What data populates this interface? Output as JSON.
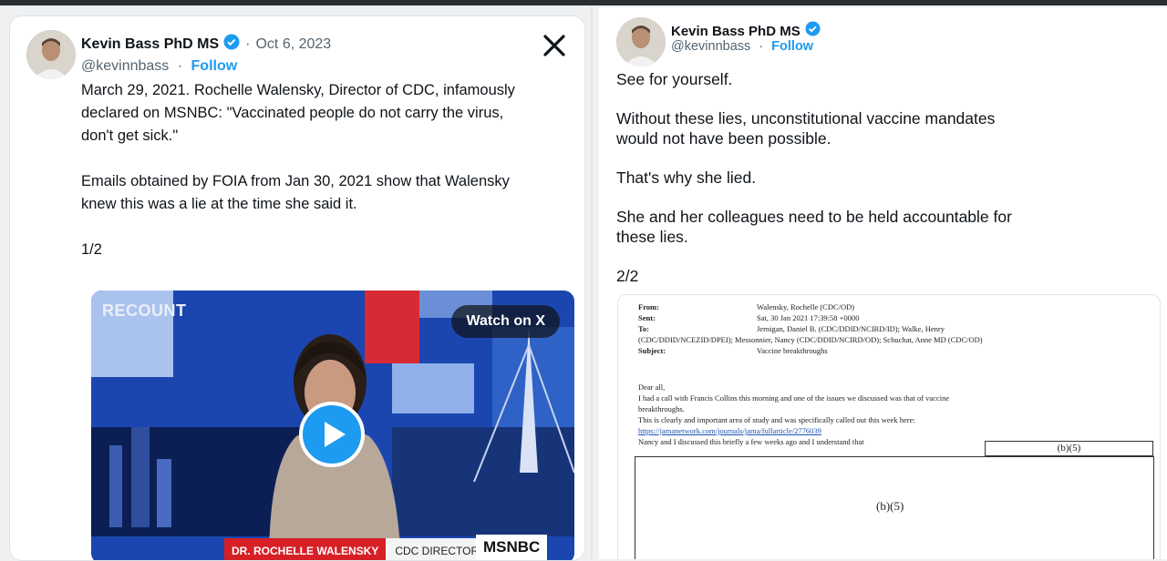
{
  "left_tweet": {
    "author_name": "Kevin Bass PhD MS",
    "date": "Oct 6, 2023",
    "handle": "@kevinnbass",
    "separator": "·",
    "follow_label": "Follow",
    "paragraphs": [
      [
        "March 29, 2021. Rochelle Walensky, Director of CDC, infamously",
        "declared on MSNBC:  \"Vaccinated people do not carry the virus,",
        "don't get sick.\""
      ],
      [
        "Emails obtained by FOIA from Jan 30, 2021 show that Walensky",
        "knew this was a lie at the time she said it."
      ],
      [
        "1/2"
      ]
    ],
    "video": {
      "brand_overlay": "RECOUNT",
      "watch_label": "Watch on X",
      "lower_third_name": "DR. ROCHELLE WALENSKY",
      "lower_third_title": "CDC DIRECTOR",
      "network": "MSNBC"
    }
  },
  "right_tweet": {
    "author_name": "Kevin Bass PhD MS",
    "handle": "@kevinnbass",
    "separator": "·",
    "follow_label": "Follow",
    "paragraphs": [
      [
        "See for yourself."
      ],
      [
        "Without these lies, unconstitutional vaccine mandates",
        "would not have been possible."
      ],
      [
        "That's why she lied."
      ],
      [
        "She and her colleagues need to be held accountable for",
        "these lies."
      ],
      [
        "2/2"
      ]
    ],
    "email": {
      "headers": [
        {
          "label": "From:",
          "value": "Walensky, Rochelle (CDC/OD)"
        },
        {
          "label": "Sent:",
          "value": "Sat, 30 Jan 2021 17:39:58 +0000"
        },
        {
          "label": "To:",
          "value": "Jernigan, Daniel B. (CDC/DDID/NCIRD/ID); Walke, Henry"
        },
        {
          "label": "",
          "value": "(CDC/DDID/NCEZID/DPEI); Messonnier, Nancy (CDC/DDID/NCIRD/OD); Schuchat, Anne MD (CDC/OD)"
        },
        {
          "label": "Subject:",
          "value": "Vaccine breakthroughs"
        }
      ],
      "body_lines": [
        "Dear all,",
        "I had a call with Francis Collins this morning and one of the issues we discussed was that of vaccine",
        "breakthroughs.",
        "This is clearly and important area of study and was specifically called out this week here:"
      ],
      "link": "https://jamanetwork.com/journals/jama/fullarticle/2776039",
      "last_line": "Nancy and I discussed this briefly a few weeks ago and I understand that",
      "redaction_small": "(b)(5)",
      "redaction_large": "(b)(5)"
    }
  },
  "colors": {
    "accent": "#1d9bf0",
    "text": "#0f1419",
    "muted": "#536471",
    "msnbc_red": "#d71f26"
  },
  "icons": [
    "verified-badge-icon",
    "x-logo-icon",
    "play-icon",
    "avatar"
  ]
}
